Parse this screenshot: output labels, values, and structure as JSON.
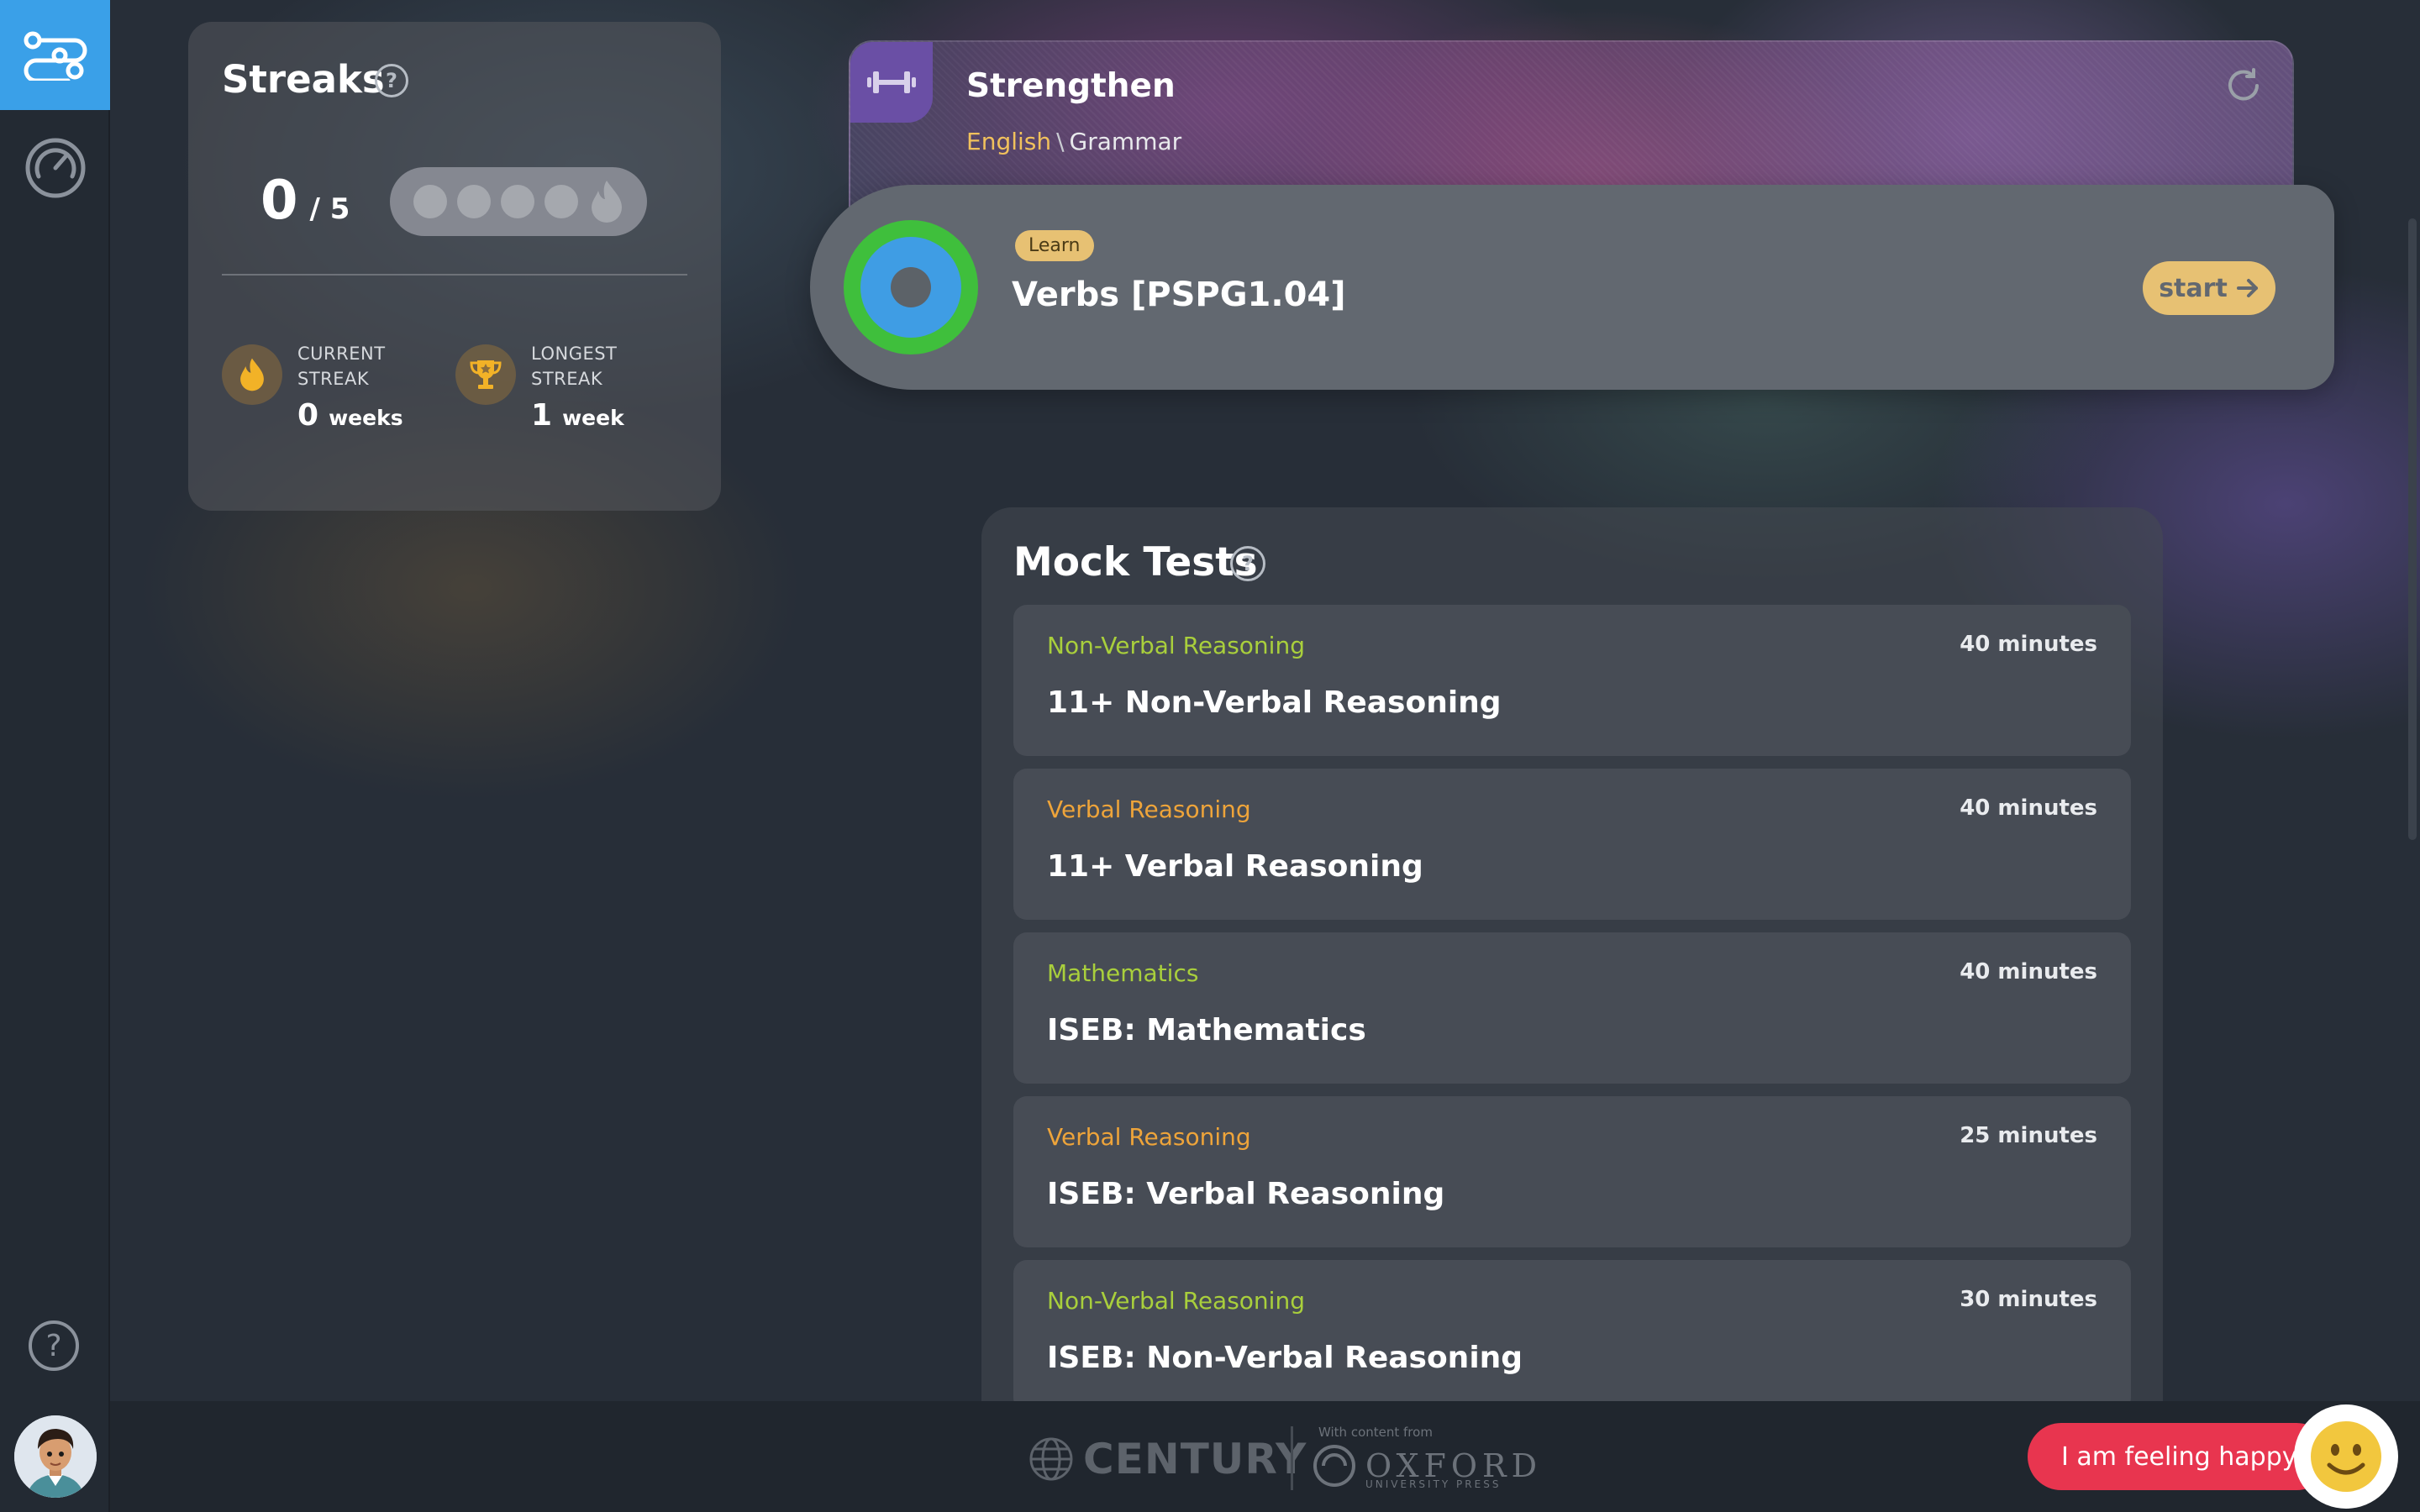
{
  "sidebar": {
    "items": [
      {
        "icon": "learning-path-icon",
        "active": true
      },
      {
        "icon": "dashboard-gauge-icon",
        "active": false
      }
    ],
    "help_label": "?",
    "accent": "#3aa0e8"
  },
  "streaks": {
    "title": "Streaks",
    "help": "?",
    "current_count": "0",
    "goal": "/ 5",
    "pips_filled": 0,
    "pips_total": 5,
    "current": {
      "label_line1": "CURRENT",
      "label_line2": "STREAK",
      "value": "0",
      "unit": "weeks"
    },
    "longest": {
      "label_line1": "LONGEST",
      "label_line2": "STREAK",
      "value": "1",
      "unit": "week"
    }
  },
  "strengthen": {
    "title": "Strengthen",
    "subject": "English",
    "separator": "\\",
    "topic": "Grammar"
  },
  "learn_item": {
    "badge": "Learn",
    "title": "Verbs [PSPG1.04]",
    "start_label": "start"
  },
  "mock_tests": {
    "title": "Mock Tests",
    "help": "?",
    "items": [
      {
        "subject": "Non-Verbal Reasoning",
        "color": "green",
        "duration": "40 minutes",
        "name": "11+ Non-Verbal Reasoning"
      },
      {
        "subject": "Verbal Reasoning",
        "color": "orange",
        "duration": "40 minutes",
        "name": "11+ Verbal Reasoning"
      },
      {
        "subject": "Mathematics",
        "color": "green",
        "duration": "40 minutes",
        "name": "ISEB: Mathematics"
      },
      {
        "subject": "Verbal Reasoning",
        "color": "orange",
        "duration": "25 minutes",
        "name": "ISEB: Verbal Reasoning"
      },
      {
        "subject": "Non-Verbal Reasoning",
        "color": "green",
        "duration": "30 minutes",
        "name": "ISEB: Non-Verbal Reasoning"
      }
    ]
  },
  "footer": {
    "brand": "CENTURY",
    "content_from": "With content from",
    "partner": "OXFORD",
    "partner_sub": "UNIVERSITY PRESS"
  },
  "mood": {
    "label": "I am feeling happy",
    "color": "#e8354f"
  }
}
